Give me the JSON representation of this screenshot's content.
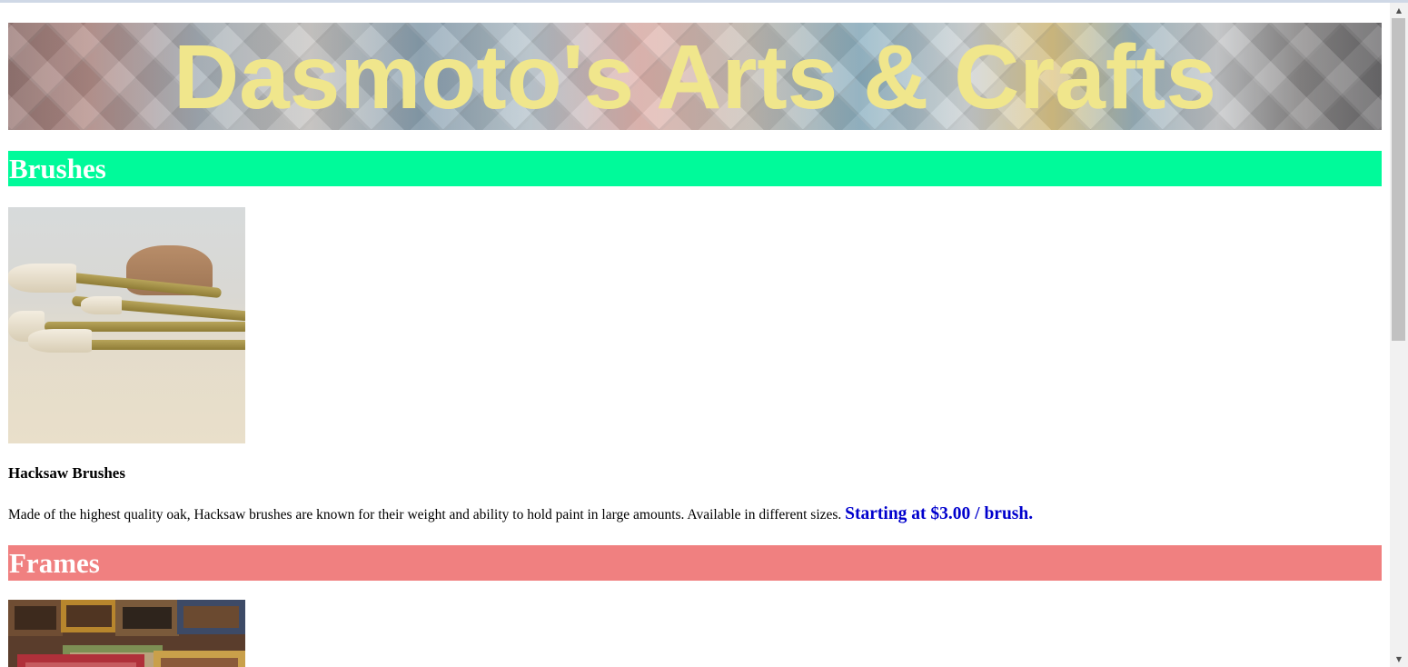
{
  "site": {
    "title": "Dasmoto's Arts & Crafts"
  },
  "sections": [
    {
      "heading": "Brushes",
      "heading_bg": "#00fa9a",
      "product": {
        "name": "Hacksaw Brushes",
        "description": "Made of the highest quality oak, Hacksaw brushes are known for their weight and ability to hold paint in large amounts. Available in different sizes.",
        "price": "Starting at $3.00 / brush."
      }
    },
    {
      "heading": "Frames",
      "heading_bg": "#f08080"
    }
  ],
  "colors": {
    "title_color": "#f0e68c",
    "heading_text": "#ffffff",
    "price_color": "#0000cd"
  },
  "scrollbar": {
    "up_arrow": "▲",
    "down_arrow": "▼"
  }
}
